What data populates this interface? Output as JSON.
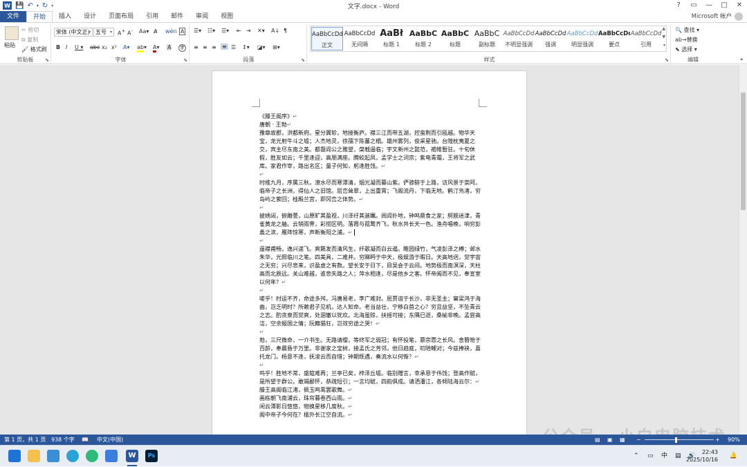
{
  "window": {
    "title": "文字.docx - Word",
    "help": "?",
    "controls": [
      "?",
      "▭",
      "—",
      "□",
      "✕"
    ]
  },
  "tabs": {
    "file": "文件",
    "items": [
      "开始",
      "插入",
      "设计",
      "页面布局",
      "引用",
      "邮件",
      "审阅",
      "视图"
    ],
    "active": "开始",
    "account": "Microsoft 帐户"
  },
  "ribbon": {
    "clipboard": {
      "paste": "粘贴",
      "cut": "剪切",
      "copy": "复制",
      "format_painter": "格式刷",
      "label": "剪贴板"
    },
    "font": {
      "font_name": "宋体 (中文正)",
      "font_size": "五号",
      "label": "字体"
    },
    "paragraph": {
      "label": "段落"
    },
    "styles": {
      "label": "样式",
      "items": [
        {
          "sample": "AaBbCcDd",
          "name": "正文"
        },
        {
          "sample": "AaBbCcDd",
          "name": "无间隔"
        },
        {
          "sample": "AaBł",
          "name": "标题 1"
        },
        {
          "sample": "AaBbC",
          "name": "标题 2"
        },
        {
          "sample": "AaBbC",
          "name": "标题"
        },
        {
          "sample": "AaBbC",
          "name": "副标题"
        },
        {
          "sample": "AaBbCcDd",
          "name": "不明显强调"
        },
        {
          "sample": "AaBbCcDd",
          "name": "强调"
        },
        {
          "sample": "AaBbCcDd",
          "name": "明显强调"
        },
        {
          "sample": "AaBbCcDd",
          "name": "要点"
        },
        {
          "sample": "AaBbCcDd",
          "name": "引用"
        }
      ]
    },
    "editing": {
      "find": "查找",
      "replace": "替换",
      "select": "选择",
      "label": "编辑"
    }
  },
  "document": {
    "paragraphs": [
      "《滕王阁序》",
      "唐朝 · 王勃",
      "豫章故郡，洪都新府。星分翼轸，地接衡庐。襟三江而带五湖，控蛮荆而引瓯越。物华天宝，龙光射牛斗之墟；人杰地灵，徐孺下陈蕃之榻。雄州雾列，俊采星驰。台隍枕夷夏之交，宾主尽东南之美。都督阎公之雅望，棨戟遥临；宇文新州之懿范，襜帷暂驻。十旬休假，胜友如云；千里逢迎，高朋满座。腾蛟起凤，孟学士之词宗；紫电青霜，王将军之武库。家君作宰，路出名区；童子何知，躬逢胜饯。",
      "",
      "时维九月，序属三秋。潦水尽而寒潭清，烟光凝而暮山紫。俨骖騑于上路，访风景于崇阿。临帝子之长洲，得仙人之旧馆。层峦耸翠，上出重霄；飞阁流丹，下临无地。鹤汀凫渚，穷岛屿之萦回；桂殿兰宫，即冈峦之体势。",
      "",
      "披绣闼，俯雕甍，山原旷其盈视，川泽纡其骇瞩。闾阎扑地，钟鸣鼎食之家；舸舰迷津，青雀黄龙之舳。云销雨霁，彩彻区明。落霞与孤鹜齐飞，秋水共长天一色。渔舟唱晚，响穷彭蠡之滨，雁阵惊寒，声断衡阳之浦。",
      "",
      "遥襟甫畅，逸兴遄飞。爽籁发而清风生，纤歌凝而白云遏。睢园绿竹，气凌彭泽之樽；邺水朱华，光照临川之笔。四美具，二难并。穷睇眄于中天，极娱游于暇日。天高地迥，觉宇宙之无穷；兴尽悲来，识盈虚之有数。望长安于日下，目吴会于云间。地势极而南溟深，天柱高而北辰远。关山难越，谁悲失路之人；萍水相逢，尽是他乡之客。怀帝阍而不见，奉宣室以何年？",
      "",
      "嗟乎！时运不齐，命途多舛。冯唐易老，李广难封。屈贾谊于长沙，非无圣主；窜梁鸿于海曲，岂乏明时？所赖君子见机，达人知命。老当益壮，宁移白首之心？穷且益坚，不坠青云之志。酌贪泉而觉爽，处涸辙以犹欢。北海虽赊，扶摇可接；东隅已逝，桑榆非晚。孟尝高洁，空余报国之情；阮籍猖狂，岂效穷途之哭！",
      "",
      "勃，三尺微命，一介书生。无路请缨，等终军之弱冠；有怀投笔，慕宗悫之长风。舍簪笏于百龄，奉晨昏于万里。非谢家之宝树，接孟氏之芳邻。他日趋庭，叨陪鲤对；今兹捧袂，喜托龙门。杨意不逢，抚凌云而自惜；钟期既遇，奏流水以何惭？",
      "",
      "呜乎！胜地不常，盛筵难再；兰亭已矣，梓泽丘墟。临别赠言，幸承恩于伟饯；登高作赋，是所望于群公。敢竭鄙怀，恭疏短引；一言均赋，四韵俱成。请洒潘江，各倾陆海云尔：",
      "滕王高阁临江渚，佩玉鸣鸾罢歌舞。",
      "画栋朝飞南浦云，珠帘暮卷西山雨。",
      "闲云潭影日悠悠，物换星移几度秋。",
      "阁中帝子今何在？槛外长江空自流。"
    ]
  },
  "status": {
    "page": "第 1 页，共 1 页",
    "words": "938 个字",
    "language": "中文(中国)",
    "zoom": "90%"
  },
  "taskbar": {
    "time": "22:43",
    "date": "2025/10/16",
    "ime": "中"
  },
  "watermark": "公众号 · 小白电脑技术"
}
